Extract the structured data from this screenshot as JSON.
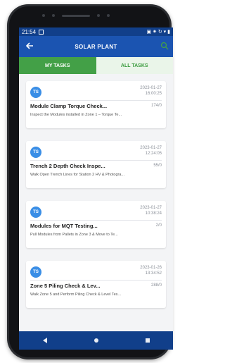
{
  "status": {
    "time": "21:54",
    "right_icons": "▣ ✷ ↻ ▾ ▮"
  },
  "header": {
    "title": "SOLAR PLANT"
  },
  "tabs": [
    {
      "label": "MY TASKS"
    },
    {
      "label": "ALL TASKS"
    }
  ],
  "tasks": [
    {
      "avatar": "TS",
      "date": "2023-01-27",
      "time": "16:00:25",
      "title": "Module Clamp Torque Check...",
      "count": "174/0",
      "desc": "Inspect the Modules installed in Zone 1 – Torque Te..."
    },
    {
      "avatar": "TS",
      "date": "2023-01-27",
      "time": "12:24:05",
      "title": "Trench 2 Depth Check Inspe...",
      "count": "55/0",
      "desc": "Walk Open Trench Lines for Station 2 HV & Photogra..."
    },
    {
      "avatar": "TS",
      "date": "2023-01-27",
      "time": "10:38:24",
      "title": "Modules for MQT Testing...",
      "count": "2/0",
      "desc": "Pull Modules from Pallets in Zone 3 & Move to Te..."
    },
    {
      "avatar": "TS",
      "date": "2023-01-26",
      "time": "13:34:52",
      "title": "Zone 5 Piling Check & Lev...",
      "count": "288/0",
      "desc": "Walk Zone 5 and Perform Piling Check & Level Tes..."
    }
  ],
  "colors": {
    "primary": "#1b54b1",
    "status_bar": "#113f8a",
    "active_tab": "#43a047",
    "avatar": "#3a8ee6"
  }
}
